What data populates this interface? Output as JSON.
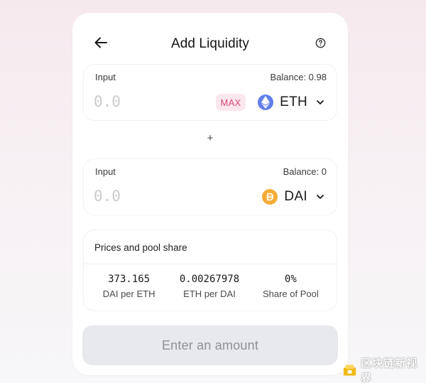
{
  "header": {
    "title": "Add Liquidity"
  },
  "input1": {
    "label": "Input",
    "balance": "Balance: 0.98",
    "placeholder": "0.0",
    "max_label": "MAX",
    "token": "ETH"
  },
  "plus": "+",
  "input2": {
    "label": "Input",
    "balance": "Balance: 0",
    "placeholder": "0.0",
    "token": "DAI"
  },
  "pool": {
    "title": "Prices and pool share",
    "stats": [
      {
        "value": "373.165",
        "label": "DAI per ETH"
      },
      {
        "value": "0.00267978",
        "label": "ETH per DAI"
      },
      {
        "value": "0%",
        "label": "Share of Pool"
      }
    ]
  },
  "submit_label": "Enter an amount",
  "watermark": "区块链新视界",
  "colors": {
    "accent_pink": "#d64a7a",
    "eth_blue": "#627eea",
    "dai_gold": "#f5ac37",
    "button_disabled": "#e8e9ed"
  },
  "icons": {
    "back": "arrow-left-icon",
    "help": "question-circle-icon",
    "eth": "ethereum-logo-icon",
    "dai": "dai-logo-icon",
    "chevron": "chevron-down-icon"
  }
}
